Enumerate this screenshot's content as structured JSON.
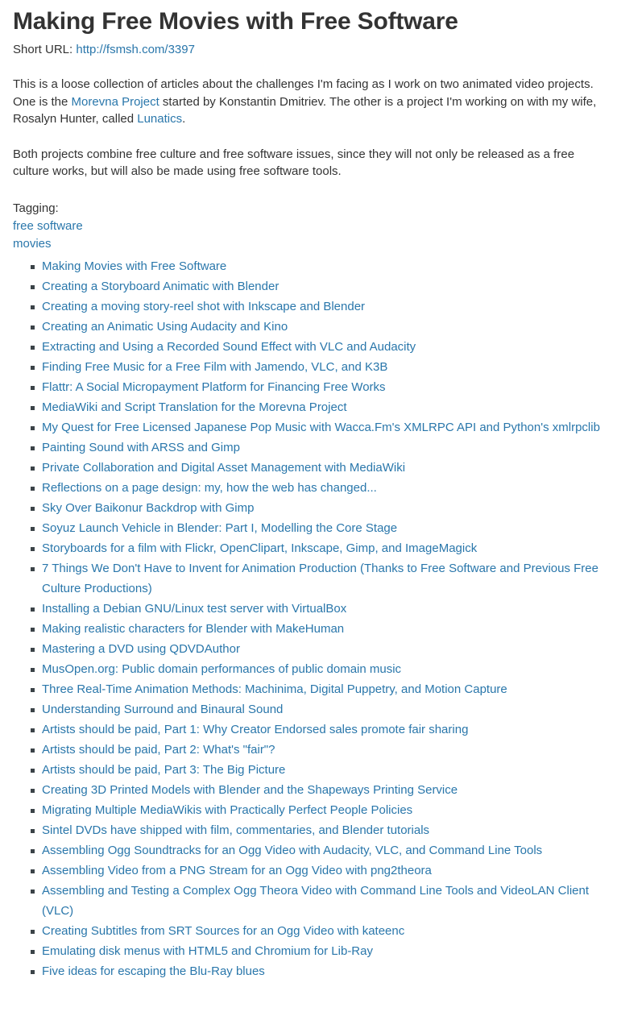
{
  "page": {
    "title": "Making Free Movies with Free Software",
    "short_url_label": "Short URL:",
    "short_url_text": "http://fsmsh.com/3397",
    "link_color": "#2a77ab",
    "text_color": "#333333",
    "bullet_color": "#3b4348",
    "background": "#ffffff"
  },
  "intro": {
    "para1_part1": "This is a loose collection of articles about the challenges I'm facing as I work on two animated video projects. One is the ",
    "para1_link1": "Morevna Project",
    "para1_part2": " started by Konstantin Dmitriev. The other is a project I'm working on with my wife, Rosalyn Hunter, called ",
    "para1_link2": "Lunatics",
    "para1_part3": ".",
    "para2": "Both projects combine free culture and free software issues, since they will not only be released as a free culture works, but will also be made using free software tools."
  },
  "tagging": {
    "label": "Tagging:",
    "tags": [
      "free software",
      "movies"
    ]
  },
  "articles": [
    "Making Movies with Free Software",
    "Creating a Storyboard Animatic with Blender",
    "Creating a moving story-reel shot with Inkscape and Blender",
    "Creating an Animatic Using Audacity and Kino",
    "Extracting and Using a Recorded Sound Effect with VLC and Audacity",
    "Finding Free Music for a Free Film with Jamendo, VLC, and K3B",
    "Flattr: A Social Micropayment Platform for Financing Free Works",
    "MediaWiki and Script Translation for the Morevna Project",
    "My Quest for Free Licensed Japanese Pop Music with Wacca.Fm's XMLRPC API and Python's xmlrpclib",
    "Painting Sound with ARSS and Gimp",
    "Private Collaboration and Digital Asset Management with MediaWiki",
    "Reflections on a page design: my, how the web has changed...",
    "Sky Over Baikonur Backdrop with Gimp",
    "Soyuz Launch Vehicle in Blender: Part I, Modelling the Core Stage",
    "Storyboards for a film with Flickr, OpenClipart, Inkscape, Gimp, and ImageMagick",
    "7 Things We Don't Have to Invent for Animation Production (Thanks to Free Software and Previous Free Culture Productions)",
    "Installing a Debian GNU/Linux test server with VirtualBox",
    "Making realistic characters for Blender with MakeHuman",
    "Mastering a DVD using QDVDAuthor",
    "MusOpen.org: Public domain performances of public domain music",
    "Three Real-Time Animation Methods: Machinima, Digital Puppetry, and Motion Capture",
    "Understanding Surround and Binaural Sound",
    "Artists should be paid, Part 1: Why Creator Endorsed sales promote fair sharing",
    "Artists should be paid, Part 2: What's \"fair\"?",
    "Artists should be paid, Part 3: The Big Picture",
    "Creating 3D Printed Models with Blender and the Shapeways Printing Service",
    "Migrating Multiple MediaWikis with Practically Perfect People Policies",
    "Sintel DVDs have shipped with film, commentaries, and Blender tutorials",
    "Assembling Ogg Soundtracks for an Ogg Video with Audacity, VLC, and Command Line Tools",
    "Assembling Video from a PNG Stream for an Ogg Video with png2theora",
    "Assembling and Testing a Complex Ogg Theora Video with Command Line Tools and VideoLAN Client (VLC)",
    "Creating Subtitles from SRT Sources for an Ogg Video with kateenc",
    "Emulating disk menus with HTML5 and Chromium for Lib-Ray",
    "Five ideas for escaping the Blu-Ray blues"
  ]
}
